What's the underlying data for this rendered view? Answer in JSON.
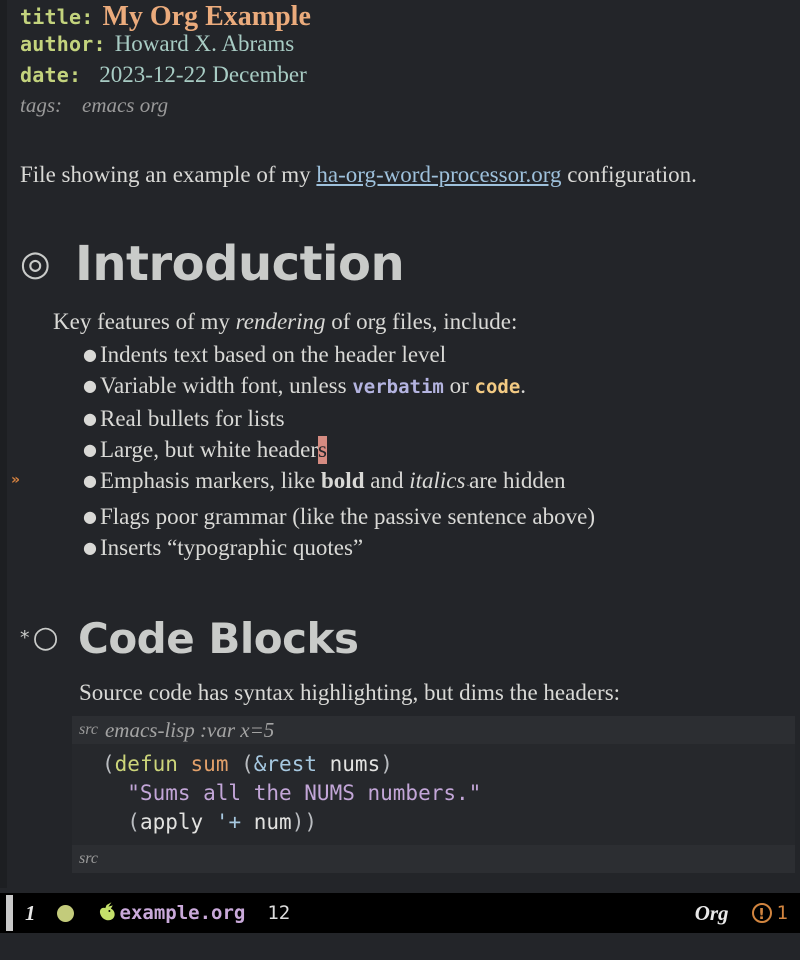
{
  "document": {
    "keywords": [
      {
        "key": "title:",
        "value": "My Org Example"
      },
      {
        "key": "author:",
        "value": "Howard X. Abrams"
      },
      {
        "key": "date:",
        "value": "2023-12-22 December"
      }
    ],
    "tags": {
      "key": "tags:",
      "value": "emacs org"
    },
    "intro": {
      "before_link": "File showing an example of my ",
      "link_text": "ha-org-word-processor.org",
      "after_link": " configuration."
    },
    "sections": [
      {
        "bullet": "◎",
        "title": "Introduction",
        "lead": {
          "part1": "Key features of my ",
          "emphasis": "rendering",
          "part2": " of org files, include:"
        },
        "items": [
          {
            "text": "Indents text based on the header level"
          },
          {
            "prefix": "Variable width font, unless ",
            "verbatim": "verbatim",
            "middle": " or ",
            "code": "code",
            "suffix": "."
          },
          {
            "text": "Real bullets for lists"
          },
          {
            "prefix": "Large, but white header",
            "cursor_char": "s",
            "suffix": ""
          },
          {
            "prefix": "Emphasis markers, like ",
            "bold": "bold",
            "middle": " and ",
            "italic": "italics",
            "caret": "ˇ",
            "suffix": "are hidden",
            "fringe_marker": "»"
          },
          {
            "text": "Flags poor grammar (like the passive sentence above)"
          },
          {
            "text": "Inserts “typographic quotes”"
          }
        ]
      },
      {
        "star": "*",
        "bullet": "○",
        "title": "Code Blocks",
        "lead": "Source code has syntax highlighting, but dims the headers:",
        "src_block": {
          "begin_keyword": "src",
          "begin_args": "emacs-lisp :var x=5",
          "end_keyword": "src",
          "lines": [
            [
              {
                "t": "(",
                "c": "cp"
              },
              {
                "t": "defun",
                "c": "ck"
              },
              {
                "t": " ",
                "c": "cn"
              },
              {
                "t": "sum",
                "c": "cf"
              },
              {
                "t": " (",
                "c": "cp"
              },
              {
                "t": "&rest",
                "c": "ca"
              },
              {
                "t": " ",
                "c": "cn"
              },
              {
                "t": "nums",
                "c": "cn"
              },
              {
                "t": ")",
                "c": "cp"
              }
            ],
            [
              {
                "t": "  \"Sums all the NUMS numbers.\"",
                "c": "cs"
              }
            ],
            [
              {
                "t": "  (",
                "c": "cp"
              },
              {
                "t": "apply",
                "c": "cn"
              },
              {
                "t": " ",
                "c": "cn"
              },
              {
                "t": "'+",
                "c": "ca"
              },
              {
                "t": " ",
                "c": "cn"
              },
              {
                "t": "num",
                "c": "cn"
              },
              {
                "t": "))",
                "c": "cp"
              }
            ]
          ]
        }
      }
    ]
  },
  "modeline": {
    "window_number": "1",
    "status_dot_color": "#c3cb7b",
    "creature_icon": "creature-icon",
    "buffer_name": "example.org",
    "column": "12",
    "major_mode": "Org",
    "warning_icon": "!",
    "warning_count": "1"
  },
  "colors": {
    "background": "#232529",
    "fringe": "#1d1f22",
    "foreground": "#d9d9d6",
    "title": "#ebab7c",
    "keyword": "#c3d37d",
    "meta_value": "#a8ccc4",
    "tags": "#9a9a9a",
    "link": "#9ec1dc",
    "headline": "#c9cbc9",
    "verbatim": "#b4b4e0",
    "code": "#f2ca83",
    "cursor": "#d58b81",
    "src_header_bg": "#2c2e32",
    "src_body_bg": "#26282c",
    "modeline_bg": "#000000",
    "modeline_buffer": "#c9a9da",
    "warning": "#d2853f"
  }
}
